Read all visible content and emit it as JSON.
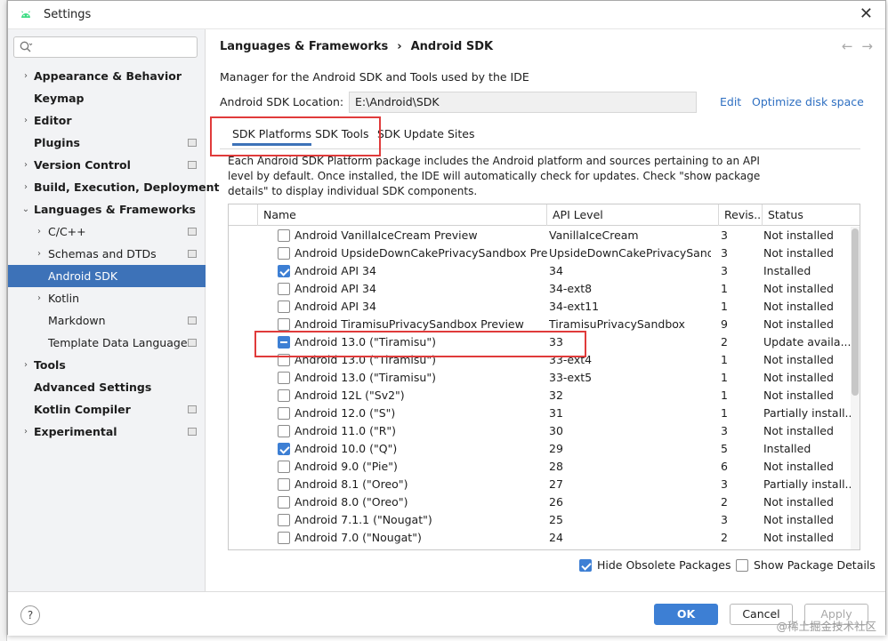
{
  "window": {
    "title": "Settings",
    "close_glyph": "✕"
  },
  "search": {
    "value": "",
    "placeholder": ""
  },
  "sidebar": {
    "items": [
      {
        "label": "Appearance & Behavior",
        "arrow": "›"
      },
      {
        "label": "Keymap",
        "arrow": ""
      },
      {
        "label": "Editor",
        "arrow": "›"
      },
      {
        "label": "Plugins",
        "arrow": ""
      },
      {
        "label": "Version Control",
        "arrow": "›"
      },
      {
        "label": "Build, Execution, Deployment",
        "arrow": "›"
      },
      {
        "label": "Languages & Frameworks",
        "arrow": "⌄"
      },
      {
        "label": "C/C++",
        "arrow": "›"
      },
      {
        "label": "Schemas and DTDs",
        "arrow": "›"
      },
      {
        "label": "Android SDK",
        "arrow": ""
      },
      {
        "label": "Kotlin",
        "arrow": "›"
      },
      {
        "label": "Markdown",
        "arrow": ""
      },
      {
        "label": "Template Data Languages",
        "arrow": ""
      },
      {
        "label": "Tools",
        "arrow": "›"
      },
      {
        "label": "Advanced Settings",
        "arrow": ""
      },
      {
        "label": "Kotlin Compiler",
        "arrow": ""
      },
      {
        "label": "Experimental",
        "arrow": "›"
      }
    ]
  },
  "header": {
    "breadcrumb_parent": "Languages & Frameworks",
    "breadcrumb_sep": "›",
    "breadcrumb_current": "Android SDK",
    "back_glyph": "←",
    "forward_glyph": "→"
  },
  "main": {
    "description": "Manager for the Android SDK and Tools used by the IDE",
    "location_label": "Android SDK Location:",
    "location_value": "E:\\Android\\SDK",
    "edit_link": "Edit",
    "optimize_link": "Optimize disk space",
    "tabs": [
      {
        "label": "SDK Platforms"
      },
      {
        "label": "SDK Tools"
      },
      {
        "label": "SDK Update Sites"
      }
    ],
    "tab_description_line1": "Each Android SDK Platform package includes the Android platform and sources pertaining to an API",
    "tab_description_line2": "level by default. Once installed, the IDE will automatically check for updates. Check \"show package",
    "tab_description_line3": "details\" to display individual SDK components."
  },
  "table": {
    "columns": [
      "Name",
      "API Level",
      "Revis...",
      "Status"
    ],
    "rows": [
      {
        "name": "Android VanillaIceCream Preview",
        "api": "VanillaIceCream",
        "rev": "3",
        "status": "Not installed",
        "check": "none"
      },
      {
        "name": "Android UpsideDownCakePrivacySandbox Preview",
        "api": "UpsideDownCakePrivacySand...",
        "rev": "3",
        "status": "Not installed",
        "check": "none"
      },
      {
        "name": "Android API 34",
        "api": "34",
        "rev": "3",
        "status": "Installed",
        "check": "checked"
      },
      {
        "name": "Android API 34",
        "api": "34-ext8",
        "rev": "1",
        "status": "Not installed",
        "check": "none"
      },
      {
        "name": "Android API 34",
        "api": "34-ext11",
        "rev": "1",
        "status": "Not installed",
        "check": "none"
      },
      {
        "name": "Android TiramisuPrivacySandbox Preview",
        "api": "TiramisuPrivacySandbox",
        "rev": "9",
        "status": "Not installed",
        "check": "none"
      },
      {
        "name": "Android 13.0 (\"Tiramisu\")",
        "api": "33",
        "rev": "2",
        "status": "Update availa...",
        "check": "partial"
      },
      {
        "name": "Android 13.0 (\"Tiramisu\")",
        "api": "33-ext4",
        "rev": "1",
        "status": "Not installed",
        "check": "none"
      },
      {
        "name": "Android 13.0 (\"Tiramisu\")",
        "api": "33-ext5",
        "rev": "1",
        "status": "Not installed",
        "check": "none"
      },
      {
        "name": "Android 12L (\"Sv2\")",
        "api": "32",
        "rev": "1",
        "status": "Not installed",
        "check": "none"
      },
      {
        "name": "Android 12.0 (\"S\")",
        "api": "31",
        "rev": "1",
        "status": "Partially install...",
        "check": "none"
      },
      {
        "name": "Android 11.0 (\"R\")",
        "api": "30",
        "rev": "3",
        "status": "Not installed",
        "check": "none"
      },
      {
        "name": "Android 10.0 (\"Q\")",
        "api": "29",
        "rev": "5",
        "status": "Installed",
        "check": "checked"
      },
      {
        "name": "Android 9.0 (\"Pie\")",
        "api": "28",
        "rev": "6",
        "status": "Not installed",
        "check": "none"
      },
      {
        "name": "Android 8.1 (\"Oreo\")",
        "api": "27",
        "rev": "3",
        "status": "Partially install...",
        "check": "none"
      },
      {
        "name": "Android 8.0 (\"Oreo\")",
        "api": "26",
        "rev": "2",
        "status": "Not installed",
        "check": "none"
      },
      {
        "name": "Android 7.1.1 (\"Nougat\")",
        "api": "25",
        "rev": "3",
        "status": "Not installed",
        "check": "none"
      },
      {
        "name": "Android 7.0 (\"Nougat\")",
        "api": "24",
        "rev": "2",
        "status": "Not installed",
        "check": "none"
      }
    ]
  },
  "options": {
    "hide_obsolete_label": "Hide Obsolete Packages",
    "show_details_label": "Show Package Details"
  },
  "footer": {
    "help_glyph": "?",
    "ok_label": "OK",
    "cancel_label": "Cancel",
    "apply_label": "Apply",
    "watermark": "@稀土掘金技术社区"
  },
  "colors": {
    "accent": "#3d7fd4",
    "selection": "#3d72b8",
    "link": "#2e6fc1",
    "annotation": "#e03b3b"
  }
}
